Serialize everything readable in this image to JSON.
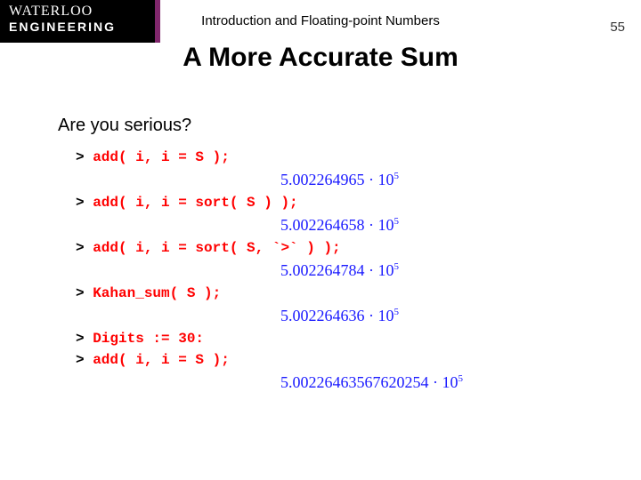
{
  "logo": {
    "line1": "WATERLOO",
    "line2": "ENGINEERING"
  },
  "header": {
    "topic": "Introduction and Floating-point Numbers",
    "page": "55"
  },
  "title": "A More Accurate Sum",
  "subhead": "Are you serious?",
  "code": {
    "l1": "add( i, i = S );",
    "r1_mant": "5.002264965",
    "r1_dot": " · 10",
    "r1_exp": "5",
    "l2": "add( i, i = sort( S ) );",
    "r2_mant": "5.002264658",
    "r2_dot": " · 10",
    "r2_exp": "5",
    "l3": "add( i, i = sort( S, `>` ) );",
    "r3_mant": "5.002264784",
    "r3_dot": " · 10",
    "r3_exp": "5",
    "l4": "Kahan_sum( S );",
    "r4_mant": "5.002264636",
    "r4_dot": " · 10",
    "r4_exp": "5",
    "l5": "Digits := 30:",
    "l6": "add( i, i = S );",
    "r6_mant": "5.00226463567620254",
    "r6_dot": " · 10",
    "r6_exp": "5"
  },
  "prompt": "> "
}
